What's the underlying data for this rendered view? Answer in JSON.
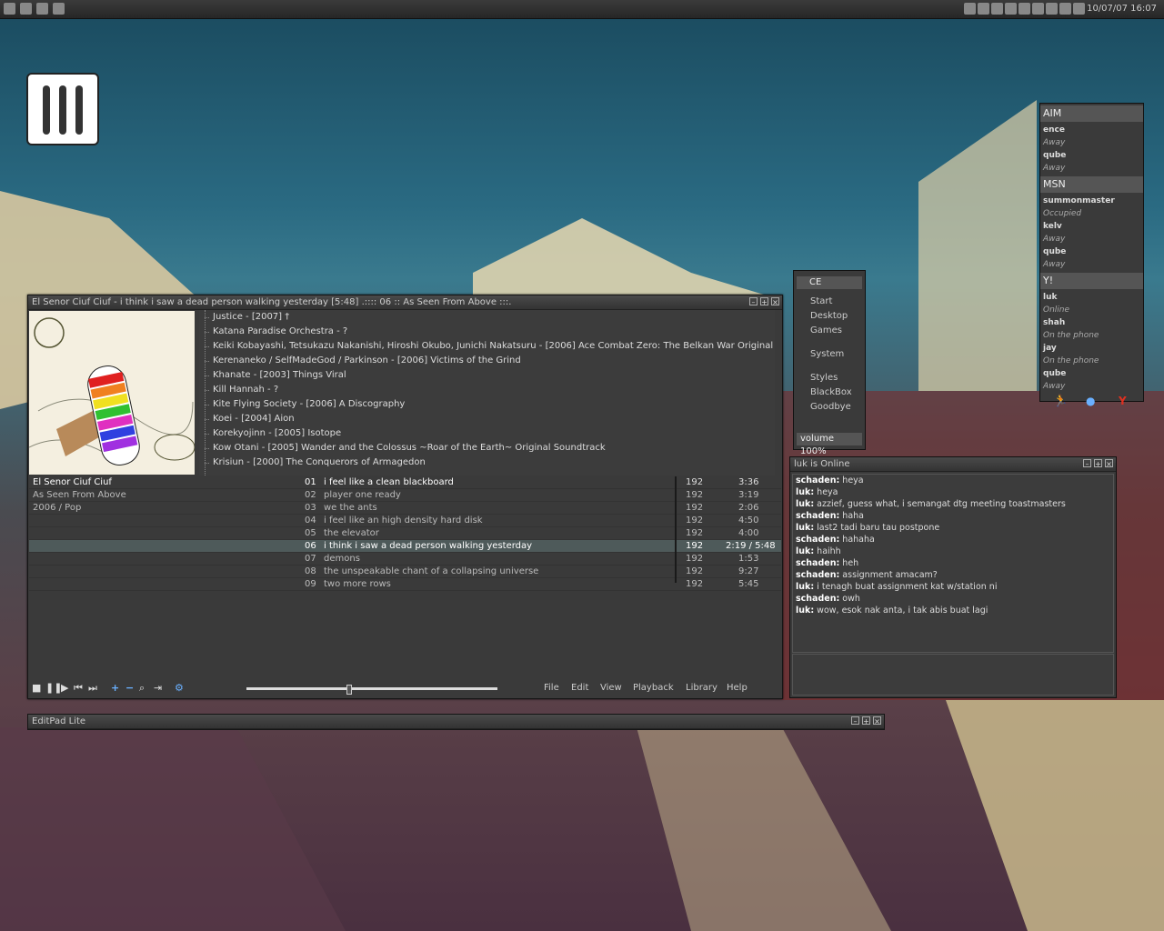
{
  "taskbar": {
    "clock": "10/07/07 16:07"
  },
  "player": {
    "title": "El Senor Ciuf Ciuf - i think i saw a dead person walking yesterday [5:48]       .:::: 06 :: As Seen From Above :::.",
    "library": [
      "Justice - [2007] †",
      "Katana Paradise Orchestra - ?",
      "Keiki Kobayashi, Tetsukazu Nakanishi, Hiroshi Okubo, Junichi Nakatsuru - [2006] Ace Combat Zero: The Belkan War Original Soundtrack",
      "Kerenaneko / SelfMadeGod / Parkinson - [2006] Victims of the Grind",
      "Khanate - [2003] Things Viral",
      "Kill Hannah - ?",
      "Kite Flying Society - [2006] A Discography",
      "Koei - [2004] Aion",
      "Korekyojinn - [2005] Isotope",
      "Kow Otani - [2005] Wander and the Colossus ~Roar of the Earth~ Original Soundtrack",
      "Krisiun - [2000] The Conquerors of Armagedon"
    ],
    "meta": [
      "El Senor Ciuf Ciuf",
      "As Seen From Above",
      "2006 / Pop"
    ],
    "tracks": [
      {
        "num": "01",
        "title": "i feel like a clean blackboard",
        "bitrate": "192",
        "time": "3:36"
      },
      {
        "num": "02",
        "title": "player one ready",
        "bitrate": "192",
        "time": "3:19"
      },
      {
        "num": "03",
        "title": "we the ants",
        "bitrate": "192",
        "time": "2:06"
      },
      {
        "num": "04",
        "title": "i feel like an high density hard disk",
        "bitrate": "192",
        "time": "4:50"
      },
      {
        "num": "05",
        "title": "the elevator",
        "bitrate": "192",
        "time": "4:00"
      },
      {
        "num": "06",
        "title": "i think i saw a dead person walking yesterday",
        "bitrate": "192",
        "time": "2:19 / 5:48"
      },
      {
        "num": "07",
        "title": "demons",
        "bitrate": "192",
        "time": "1:53"
      },
      {
        "num": "08",
        "title": "the unspeakable chant of a collapsing universe",
        "bitrate": "192",
        "time": "9:27"
      },
      {
        "num": "09",
        "title": "two more rows",
        "bitrate": "192",
        "time": "5:45"
      }
    ],
    "progress": 0.4,
    "menu": [
      "File",
      "Edit",
      "View",
      "Playback",
      "Library",
      "Help"
    ]
  },
  "bbmenu": {
    "header": "CE",
    "items": [
      "Start",
      "Desktop",
      "Games",
      "",
      "System",
      "",
      "Styles",
      "BlackBox",
      "Goodbye"
    ],
    "footer": "volume 100%"
  },
  "buddies": [
    {
      "group": "AIM",
      "members": [
        {
          "name": "ence",
          "status": "Away"
        },
        {
          "name": "qube",
          "status": "Away"
        }
      ]
    },
    {
      "group": "MSN",
      "members": [
        {
          "name": "summonmaster",
          "status": "Occupied"
        },
        {
          "name": "kelv",
          "status": "Away"
        },
        {
          "name": "qube",
          "status": "Away"
        }
      ]
    },
    {
      "group": "Y!",
      "members": [
        {
          "name": "luk",
          "status": "Online"
        },
        {
          "name": "shah",
          "status": "On the phone"
        },
        {
          "name": "jay",
          "status": "On the phone"
        },
        {
          "name": "qube",
          "status": "Away"
        }
      ]
    }
  ],
  "chat": {
    "title": "luk is Online",
    "lines": [
      {
        "who": "schaden:",
        "msg": "heya"
      },
      {
        "who": "luk:",
        "msg": "heya"
      },
      {
        "who": "luk:",
        "msg": "azzief, guess what, i semangat dtg meeting toastmasters"
      },
      {
        "who": "schaden:",
        "msg": "haha"
      },
      {
        "who": "luk:",
        "msg": "last2 tadi baru tau postpone"
      },
      {
        "who": "schaden:",
        "msg": "hahaha"
      },
      {
        "who": "luk:",
        "msg": "haihh"
      },
      {
        "who": "schaden:",
        "msg": "heh"
      },
      {
        "who": "schaden:",
        "msg": "assignment amacam?"
      },
      {
        "who": "luk:",
        "msg": "i tenagh buat assignment kat w/station ni"
      },
      {
        "who": "schaden:",
        "msg": "owh"
      },
      {
        "who": "luk:",
        "msg": "wow, esok nak anta, i tak abis buat lagi"
      }
    ]
  },
  "editpad": {
    "title": "EditPad Lite"
  },
  "colors": {
    "highlight": "#4e5a5a",
    "window": "#3a3a3a"
  }
}
